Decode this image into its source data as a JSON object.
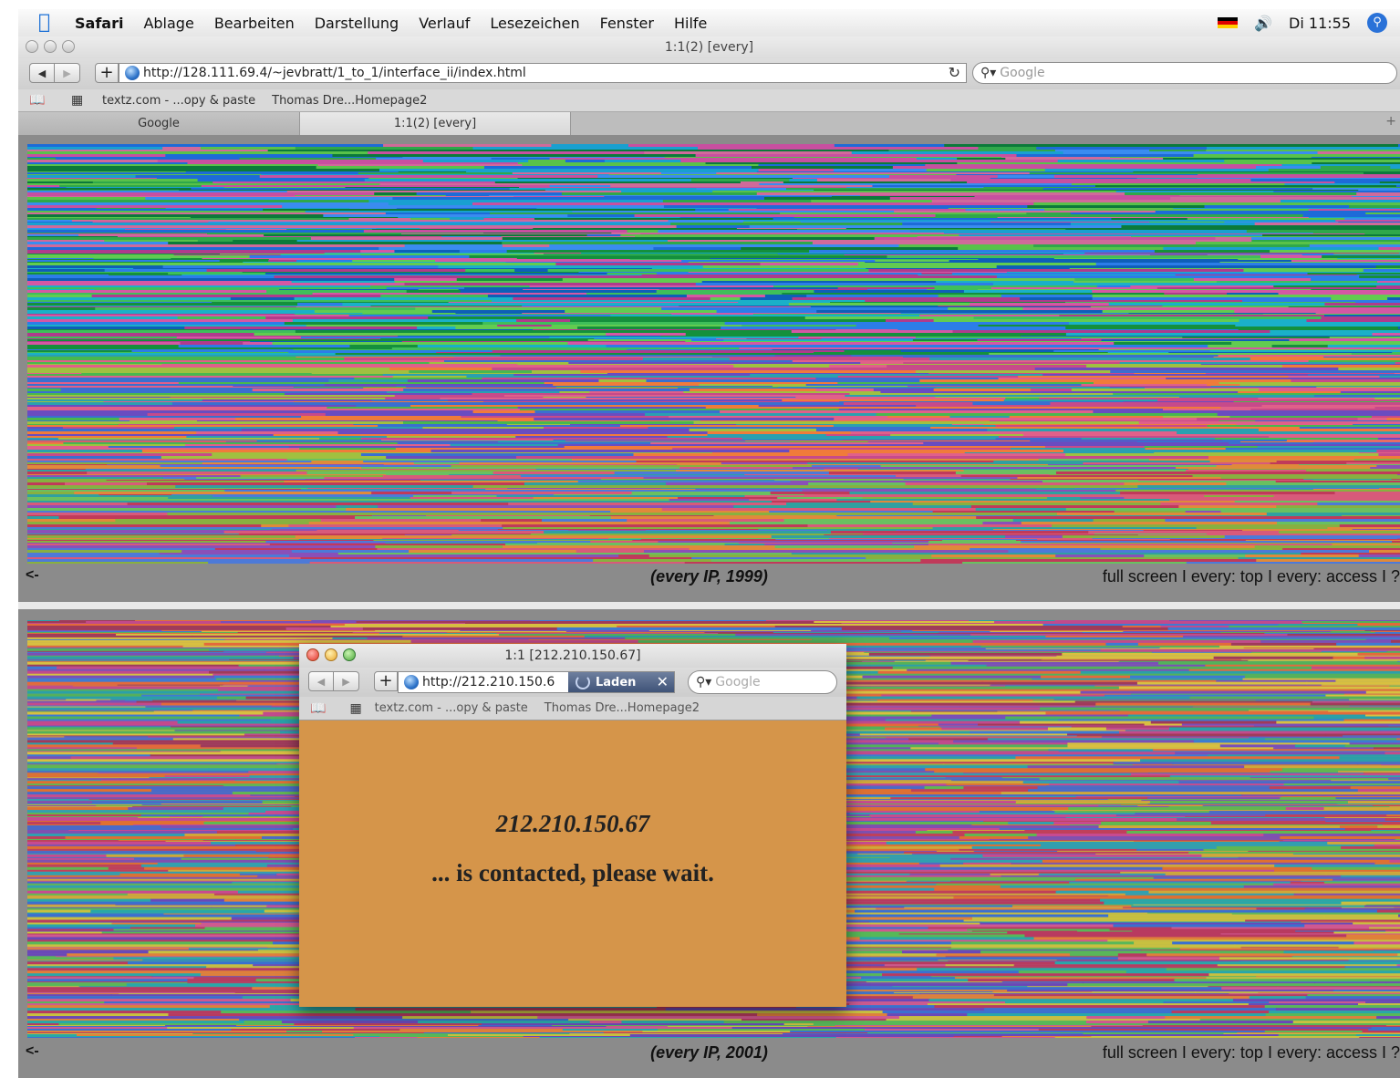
{
  "menubar": {
    "app": "Safari",
    "items": [
      "Ablage",
      "Bearbeiten",
      "Darstellung",
      "Verlauf",
      "Lesezeichen",
      "Fenster",
      "Hilfe"
    ],
    "clock": "Di 11:55",
    "icons": [
      "apple-icon",
      "flag-icon",
      "volume-icon",
      "spotlight-icon"
    ]
  },
  "window": {
    "title": "1:1(2) [every]",
    "url": "http://128.111.69.4/~jevbratt/1_to_1/interface_ii/index.html",
    "search_placeholder": "Google",
    "bookmarks": [
      "textz.com - ...opy & paste",
      "Thomas Dre...Homepage2"
    ],
    "tabs": [
      {
        "label": "Google",
        "active": false
      },
      {
        "label": "1:1(2) [every]",
        "active": true
      }
    ]
  },
  "frames": [
    {
      "caption": "(every IP, 1999)",
      "back": "<-",
      "links": "full screen I every: top I every: access I ?"
    },
    {
      "caption": "(every IP, 2001)",
      "back": "<-",
      "links": "full screen I every: top I every: access I ?"
    }
  ],
  "popup": {
    "title": "1:1 [212.210.150.67]",
    "url": "http://212.210.150.6",
    "loading_label": "Laden",
    "search_placeholder": "Google",
    "bookmarks": [
      "textz.com - ...opy & paste",
      "Thomas Dre...Homepage2"
    ],
    "ip": "212.210.150.67",
    "message": "... is contacted, please wait.",
    "background_color": "#d5954a"
  },
  "colors": {
    "accent": "#2a72d8",
    "frame_gray": "#8b8b8b"
  }
}
